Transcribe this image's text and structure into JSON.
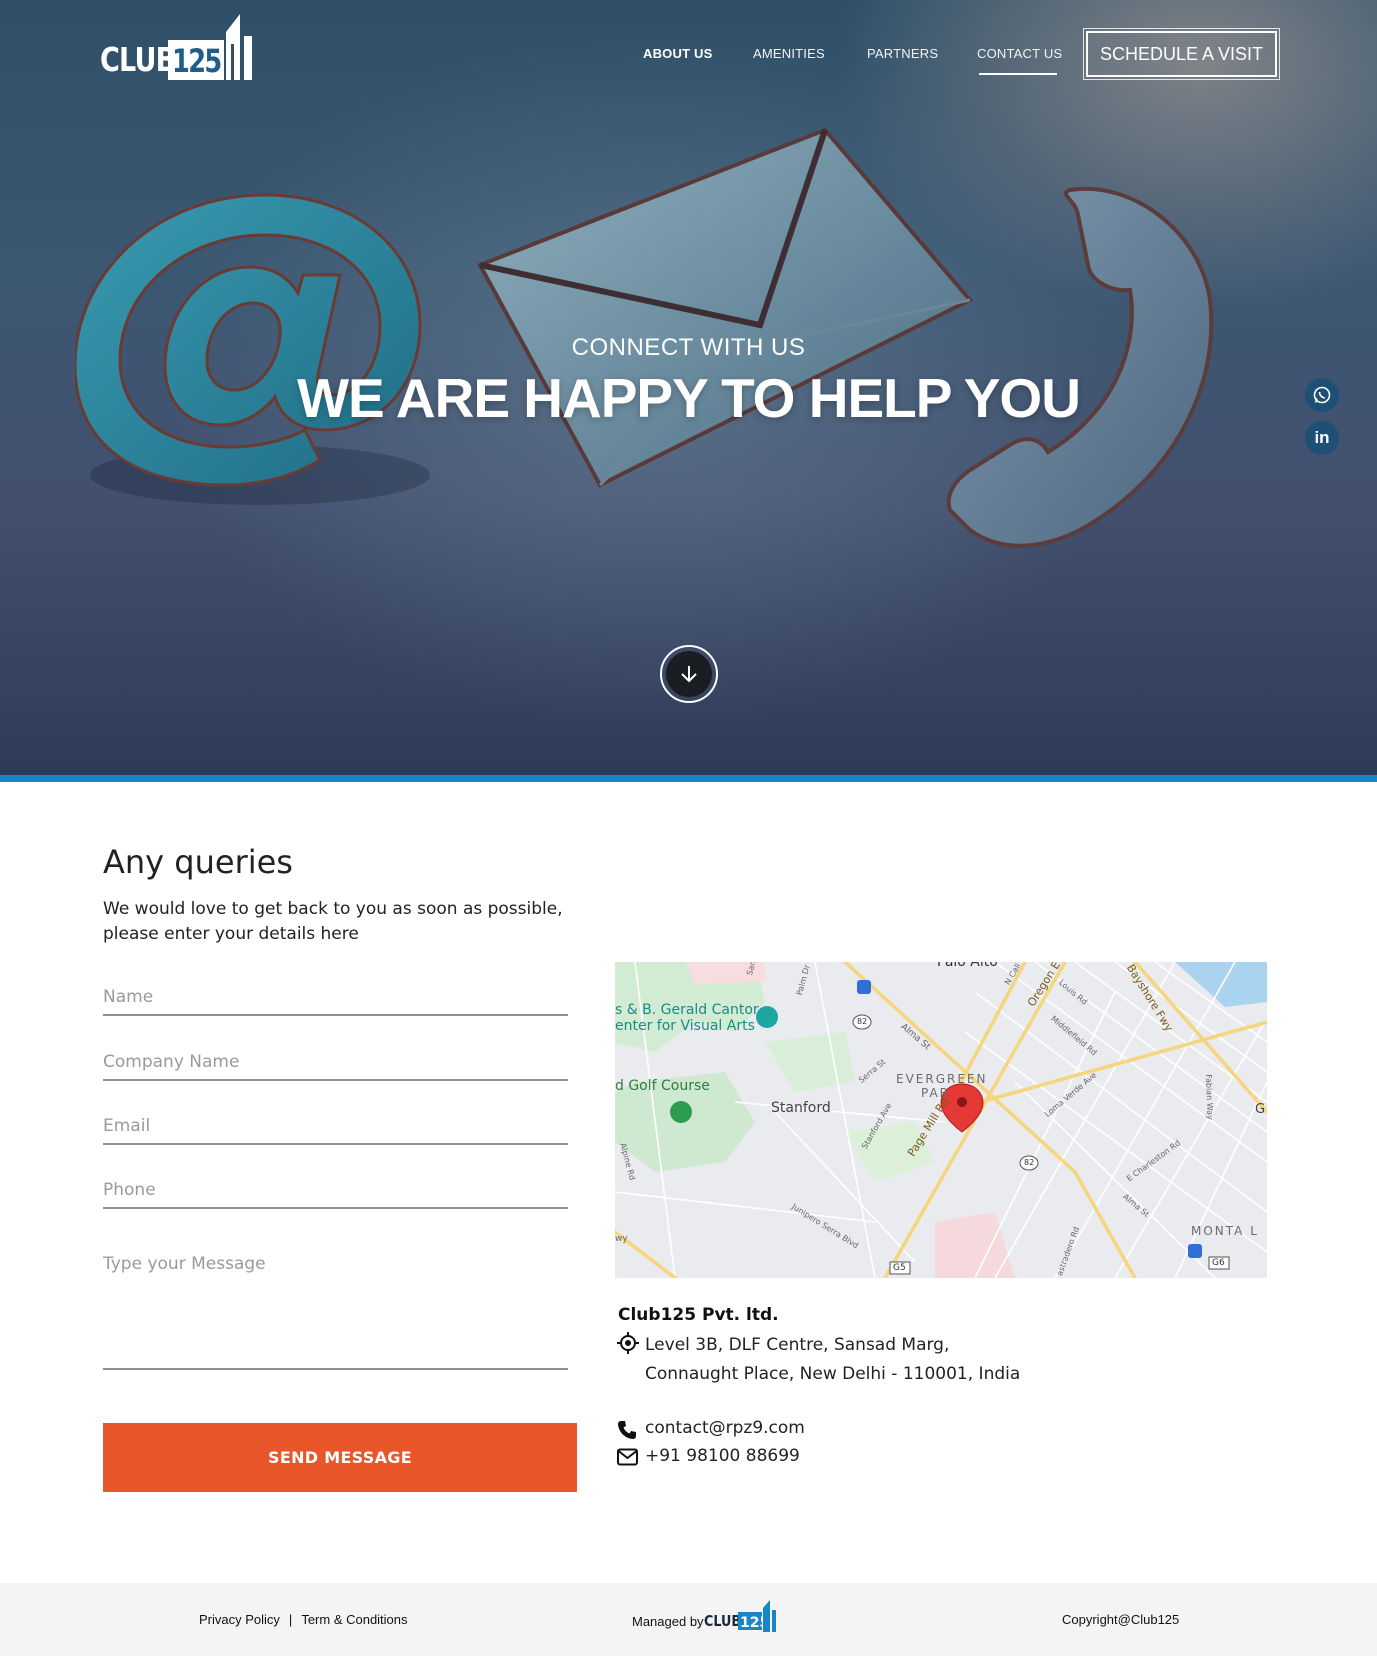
{
  "brand": {
    "club_text": "CLUB",
    "number_text": "125",
    "accent_blue": "#1a86c8",
    "navy": "#1e4f74",
    "cta_orange": "#e8562a"
  },
  "nav": {
    "items": [
      {
        "label": "ABOUT US"
      },
      {
        "label": "AMENITIES"
      },
      {
        "label": "PARTNERS"
      },
      {
        "label": "CONTACT US"
      }
    ],
    "active": "CONTACT US",
    "cta_label": "SCHEDULE A VISIT"
  },
  "hero": {
    "subtitle": "CONNECT WITH US",
    "title": "WE ARE HAPPY TO HELP YOU",
    "scroll_icon": "arrow-down-icon"
  },
  "social": {
    "items": [
      {
        "icon": "whatsapp-icon"
      },
      {
        "icon": "linkedin-icon",
        "text": "in"
      }
    ]
  },
  "form": {
    "title": "Any queries",
    "description": "We would love to get back to you as soon as possible, please enter your details here",
    "name_placeholder": "Name",
    "company_placeholder": "Company Name",
    "email_placeholder": "Email",
    "phone_placeholder": "Phone",
    "message_placeholder": "Type your Message",
    "submit_label": "SEND MESSAGE"
  },
  "map": {
    "labels": {
      "palo_alto": "Palo Alto",
      "cantor": "s & B. Gerald Cantor",
      "cantor2": "enter for Visual Arts",
      "golf": "d Golf Course",
      "stanford": "Stanford",
      "evergreen": "EVERGREEN",
      "park": "PAR",
      "page_mill": "Page Mill Rd",
      "alma": "Alma St",
      "oregon": "Oregon E",
      "bayshore": "Bayshore Fwy",
      "middlefield": "Middlefield Rd",
      "loma_verde": "Loma Verde Ave",
      "monta": "MONTA L",
      "charleston": "E Charleston Rd",
      "junipero": "Junipero Serra Blvd",
      "stanford_ave": "Stanford Ave",
      "serra": "Serra St",
      "r82": "82",
      "r82b": "82",
      "g5": "G5",
      "g6": "G6",
      "alpine": "Alpine Rd",
      "fabian": "Fabian Way",
      "louis": "Louis Rd",
      "palm": "Palm Dr",
      "san": "San",
      "n_cal": "N Cali",
      "alma2": "Alma St",
      "g_edge": "G",
      "wy": "wy",
      "astradero": "astradero Rd"
    }
  },
  "contact": {
    "company": "Club125 Pvt. ltd.",
    "address_line1": "Level 3B, DLF Centre, Sansad Marg,",
    "address_line2": "Connaught Place, New Delhi - 110001, India",
    "email": "contact@rpz9.com",
    "phone": "+91 98100 88699"
  },
  "footer": {
    "privacy": "Privacy Policy",
    "separator": "|",
    "terms": "Term & Conditions",
    "managed_by": "Managed by",
    "copyright": "Copyright@Club125"
  }
}
